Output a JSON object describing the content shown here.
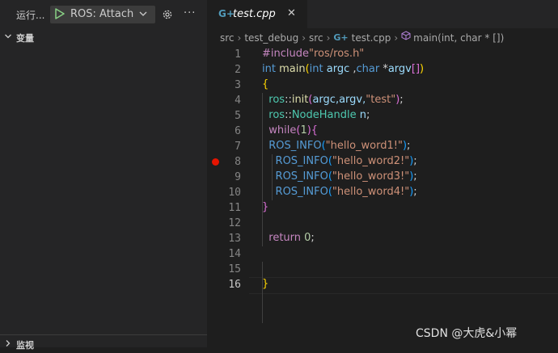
{
  "sidebar": {
    "run_label": "运行...",
    "launch_config": "ROS: Attach",
    "sections": {
      "variables": "变量",
      "watch": "监视"
    }
  },
  "editor": {
    "tab": {
      "label": "test.cpp",
      "icon": "C++"
    },
    "breadcrumbs": [
      "src",
      "test_debug",
      "src",
      "test.cpp",
      "main(int, char * [])"
    ],
    "breakpoint_line": 8,
    "active_line": 16,
    "lines": [
      {
        "n": "1"
      },
      {
        "n": "2"
      },
      {
        "n": "3"
      },
      {
        "n": "4"
      },
      {
        "n": "5"
      },
      {
        "n": "6"
      },
      {
        "n": "7"
      },
      {
        "n": "8"
      },
      {
        "n": "9"
      },
      {
        "n": "10"
      },
      {
        "n": "11"
      },
      {
        "n": "12"
      },
      {
        "n": "13"
      },
      {
        "n": "14"
      },
      {
        "n": "15"
      },
      {
        "n": "16"
      }
    ],
    "code": {
      "l1_directive": "#include",
      "l1_path": "\"ros/ros.h\"",
      "l2_int1": "int",
      "l2_main": "main",
      "l2_paren_open": "(",
      "l2_int2": "int",
      "l2_argc": "argc",
      "l2_comma": " ,",
      "l2_char": "char",
      "l2_star": " *",
      "l2_argv": "argv",
      "l2_brackets": "[]",
      "l2_paren_close": ")",
      "l3_brace": "{",
      "l4_ns": "ros",
      "l4_sep": "::",
      "l4_fn": "init",
      "l4_open": "(",
      "l4_args": "argc,argv,",
      "l4_str": "\"test\"",
      "l4_close": ")",
      "l4_semi": ";",
      "l5_ns": "ros",
      "l5_sep": "::",
      "l5_type": "NodeHandle",
      "l5_var": " n",
      "l5_semi": ";",
      "l6_while": "while",
      "l6_open": "(",
      "l6_num": "1",
      "l6_close": ")",
      "l6_brace": "{",
      "l7_macro": "ROS_INFO",
      "l7_open": "(",
      "l7_str": "\"hello_word1!\"",
      "l7_close": ")",
      "l7_semi": ";",
      "l8_macro": "ROS_INFO",
      "l8_open": "(",
      "l8_str": "\"hello_word2!\"",
      "l8_close": ")",
      "l8_semi": ";",
      "l9_macro": "ROS_INFO",
      "l9_open": "(",
      "l9_str": "\"hello_word3!\"",
      "l9_close": ")",
      "l9_semi": ";",
      "l10_macro": "ROS_INFO",
      "l10_open": "(",
      "l10_str": "\"hello_word4!\"",
      "l10_close": ")",
      "l10_semi": ";",
      "l11_brace": "}",
      "l13_return": "return",
      "l13_num": " 0",
      "l13_semi": ";",
      "l16_brace": "}"
    }
  },
  "watermark": "CSDN @大虎&小幂",
  "colors": {
    "accent_play": "#89d185",
    "breakpoint": "#e51400",
    "cpp_icon": "#519aba"
  }
}
